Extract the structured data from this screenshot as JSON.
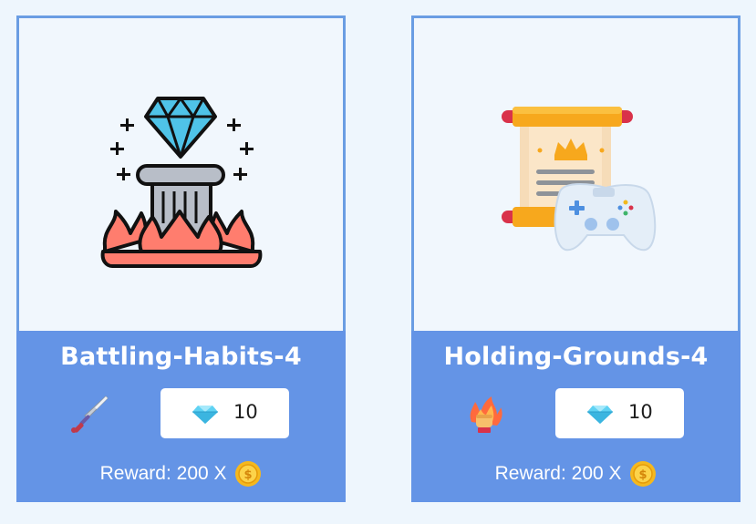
{
  "cards": [
    {
      "title": "Battling-Habits-4",
      "image_icon": "diamond-pillar-fire-icon",
      "tool_icon": "sword-icon",
      "cost": "10",
      "cost_icon": "diamond-icon",
      "reward_label": "Reward: 200 X",
      "reward_icon": "coin-icon"
    },
    {
      "title": "Holding-Grounds-4",
      "image_icon": "scroll-gamepad-icon",
      "tool_icon": "fire-fist-icon",
      "cost": "10",
      "cost_icon": "diamond-icon",
      "reward_label": "Reward: 200 X",
      "reward_icon": "coin-icon"
    }
  ],
  "colors": {
    "page_background": "#eef6fd",
    "card_footer": "#6494e6",
    "card_border": "#6a9de3",
    "diamond": "#4fc3e8",
    "coin": "#f5b81e"
  }
}
